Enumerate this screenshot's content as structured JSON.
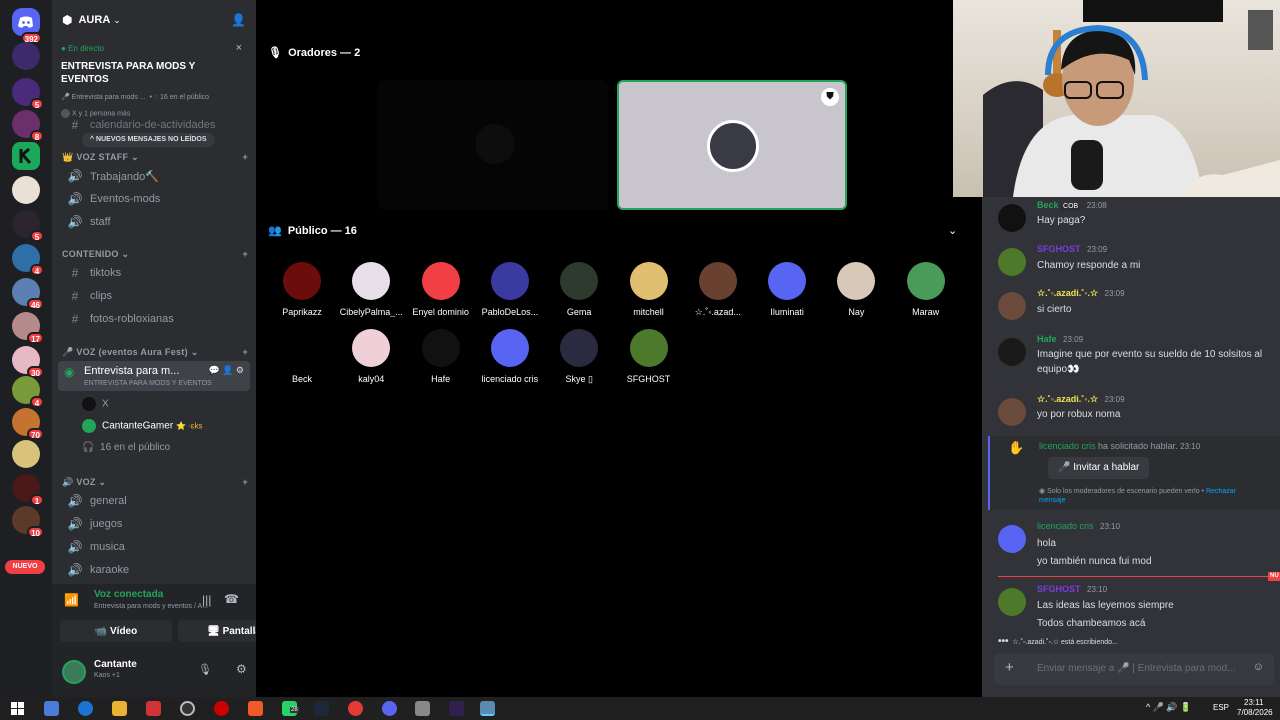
{
  "server": {
    "name": "AURA"
  },
  "rail": {
    "unread_top": "392",
    "new_label": "NUEVO",
    "badges": [
      "5",
      "8",
      "5",
      "4",
      "46",
      "17",
      "30",
      "4",
      "70",
      "1",
      "10"
    ]
  },
  "live_banner": {
    "status": "En directo",
    "title": "ENTREVISTA PARA MODS Y EVENTOS",
    "meta_channel": "Entrevista para mods ...",
    "meta_audience": "16 en el público",
    "meta_people": "X y 1 persona más"
  },
  "sidebar": {
    "partial_channel": "calendario-de-actividades",
    "new_messages_pill": "NUEVOS MENSAJES NO LEÍDOS",
    "categories": [
      {
        "name": "VOZ STAFF",
        "channels": [
          "Trabajando🔨",
          "Eventos-mods",
          "staff"
        ]
      },
      {
        "name": "CONTENIDO",
        "channels": [
          "tiktoks",
          "clips",
          "fotos-robloxianas"
        ]
      },
      {
        "name": "VOZ (eventos Aura Fest)",
        "channels": [
          "Entrevista para m..."
        ]
      },
      {
        "name": "VOZ",
        "channels": [
          "general",
          "juegos",
          "musica",
          "karaoke"
        ]
      }
    ],
    "active_sub": "ENTREVISTA PARA MODS Y EVENTOS",
    "stage_users": [
      "X",
      "CantanteGamer"
    ],
    "cantante_tag": "⭐ ·ɛks",
    "audience_count": "16 en el público"
  },
  "voice_panel": {
    "status": "Voz conectada",
    "channel": "Entrevista para mods y eventos / A...",
    "video_label": "Vídeo",
    "screen_label": "Pantalla"
  },
  "user_panel": {
    "name": "Cantante",
    "status": "Kaos +1"
  },
  "stage": {
    "speakers_title": "Oradores — 2",
    "audience_title": "Público — 16",
    "audience": [
      "Paprikazz",
      "CibelyPalma_...",
      "Enyel dominio",
      "PabloDeLos...",
      "Gema",
      "mitchell",
      "☆.˚◦.azad...",
      "Iluminati",
      "Nay",
      "Maraw",
      "Beck",
      "kaly04",
      "Hafe",
      "licenciado cris",
      "Skye ▯",
      "SFGHOST"
    ]
  },
  "chat": {
    "messages": [
      {
        "user": "Beck",
        "tag": "COB",
        "time": "23:08",
        "lines": [
          "Hay paga?"
        ]
      },
      {
        "user": "SFGHOST",
        "time": "23:09",
        "lines": [
          "Chamoy responde a mi"
        ]
      },
      {
        "user": "☆.˚◦.azadi.˚◦.☆",
        "time": "23:09",
        "lines": [
          "si cierto"
        ]
      },
      {
        "user": "Hafe",
        "time": "23:09",
        "lines": [
          "Imagine que por evento su sueldo de 10 solsitos al",
          "equipo👀"
        ]
      },
      {
        "user": "☆.˚◦.azadi.˚◦.☆",
        "time": "23:09",
        "lines": [
          "yo por robux noma"
        ]
      },
      {
        "user": "licenciado cris",
        "time": "23:10",
        "lines": [
          "hola",
          "yo también nunca fui mod"
        ]
      },
      {
        "user": "SFGHOST",
        "time": "23:10",
        "lines": [
          "Las ideas las leyemos siempre",
          "Todos chambeamos acá"
        ]
      }
    ],
    "request": {
      "user": "licenciado cris",
      "action": "ha solicitado hablar.",
      "time": "23:10",
      "button": "Invitar a hablar",
      "note": "Solo los moderadores de escenario pueden verlo •",
      "reject": "Rechazar",
      "reject2": "mensaje"
    },
    "new_marker": "NU",
    "typing": "☆.˚◦.azadi.˚◦.☆ está escribiendo...",
    "input_placeholder": "Enviar mensaje a 🎤 | Entrevista para mod..."
  },
  "taskbar": {
    "lang": "ESP",
    "time": "23:11",
    "date": "7/08/2026",
    "chat_badge": "28"
  },
  "colors": {
    "green": "#23a559",
    "red": "#f23f43",
    "blurple": "#5865f2",
    "purple": "#7b3ddb"
  }
}
